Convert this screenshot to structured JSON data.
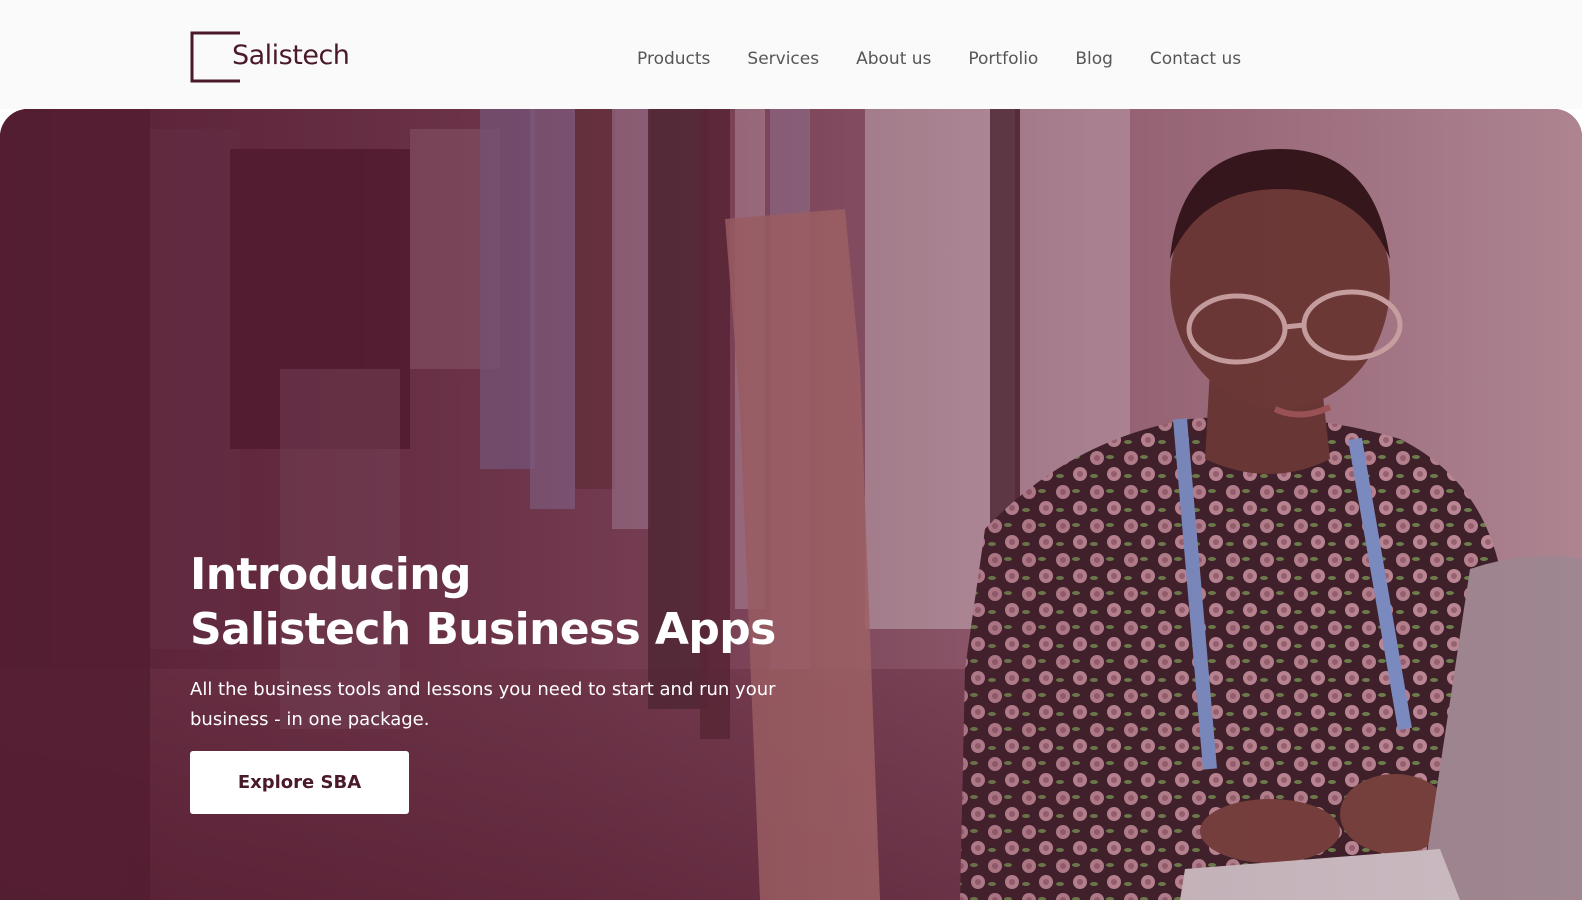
{
  "brand": {
    "name": "Salistech",
    "color": "#4a1a2c"
  },
  "nav": {
    "items": [
      {
        "label": "Products"
      },
      {
        "label": "Services"
      },
      {
        "label": "About us"
      },
      {
        "label": "Portfolio"
      },
      {
        "label": "Blog"
      },
      {
        "label": "Contact us"
      }
    ]
  },
  "hero": {
    "title_line1": "Introducing",
    "title_line2": "Salistech Business Apps",
    "subtitle": "All the business tools and lessons you need to start and run your business - in one package.",
    "cta_label": "Explore SBA",
    "overlay_color": "#581e34"
  }
}
